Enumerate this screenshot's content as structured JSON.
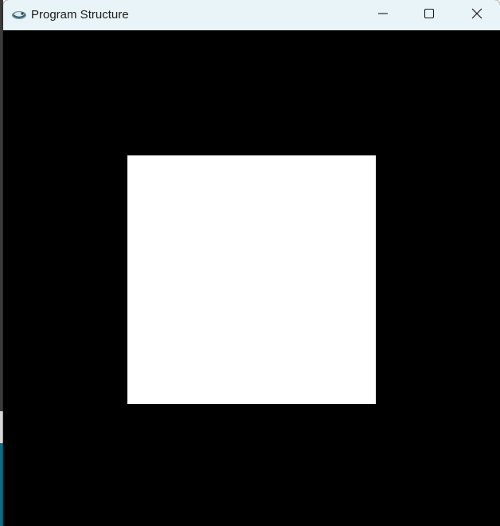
{
  "window": {
    "title": "Program Structure",
    "icon": "app-icon",
    "titlebar_color": "#e9f4f8",
    "client_background": "#000000"
  },
  "controls": {
    "minimize_icon": "minimize-icon",
    "maximize_icon": "maximize-icon",
    "close_icon": "close-icon"
  },
  "canvas": {
    "shape": "square",
    "shape_color": "#ffffff"
  }
}
